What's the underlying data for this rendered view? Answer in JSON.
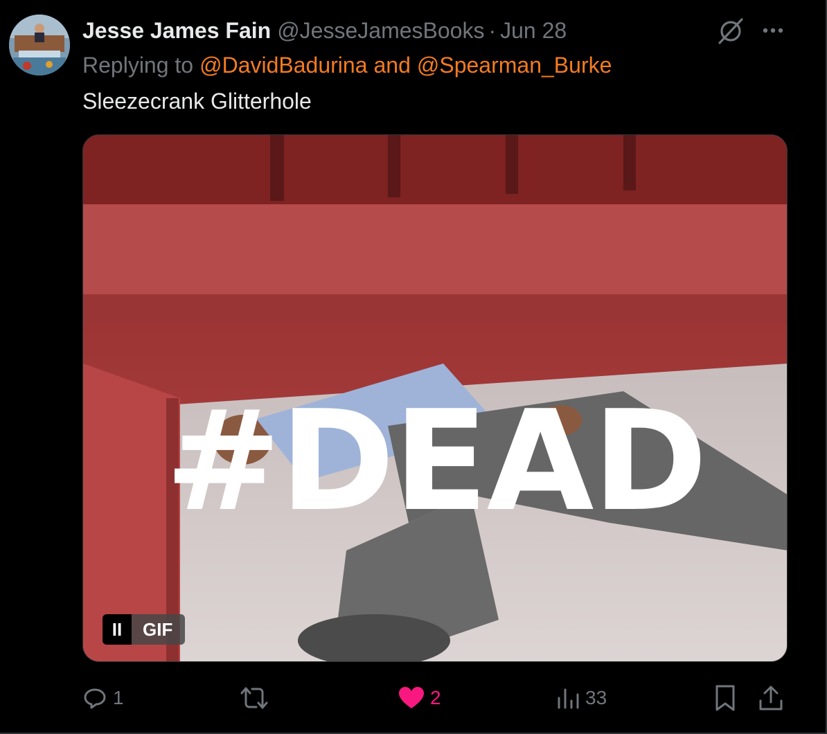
{
  "tweet": {
    "display_name": "Jesse James Fain",
    "handle": "@JesseJamesBooks",
    "separator": "·",
    "timestamp": "Jun 28",
    "reply_prefix": "Replying to",
    "mention_1": "@DavidBadurina",
    "mention_joiner": "and",
    "mention_2": "@Spearman_Burke",
    "text": "Sleezecrank Glitterhole"
  },
  "media": {
    "overlay_text": "#DEAD",
    "pause_glyph": "II",
    "gif_label": "GIF"
  },
  "actions": {
    "reply_count": "1",
    "retweet_count": "",
    "like_count": "2",
    "views_count": "33",
    "like_active": true,
    "like_color": "#f91880"
  },
  "colors": {
    "mention": "#f47b20",
    "secondary_text": "#71767b",
    "primary_text": "#e7e9ea",
    "background": "#000000"
  },
  "icons": [
    "grok-icon",
    "more-icon",
    "reply-icon",
    "retweet-icon",
    "heart-icon",
    "views-icon",
    "bookmark-icon",
    "share-icon",
    "pause-icon"
  ]
}
